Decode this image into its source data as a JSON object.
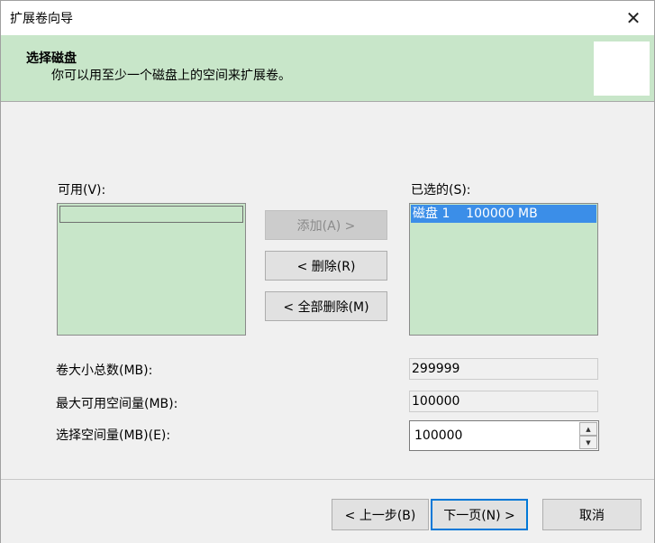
{
  "window": {
    "title": "扩展卷向导",
    "close_glyph": "✕"
  },
  "header": {
    "title": "选择磁盘",
    "subtitle": "你可以用至少一个磁盘上的空间来扩展卷。"
  },
  "available": {
    "label": "可用(V):"
  },
  "selected": {
    "label": "已选的(S):",
    "items": [
      "磁盘 1    100000 MB"
    ]
  },
  "buttons": {
    "add": "添加(A) >",
    "remove": "< 删除(R)",
    "remove_all": "< 全部删除(M)"
  },
  "fields": {
    "total_label": "卷大小总数(MB):",
    "total_value": "299999",
    "max_label": "最大可用空间量(MB):",
    "max_value": "100000",
    "select_label": "选择空间量(MB)(E):",
    "select_value": "100000"
  },
  "footer": {
    "back": "< 上一步(B)",
    "next": "下一页(N) >",
    "cancel": "取消"
  },
  "colors": {
    "accent_green": "#c8e6c9",
    "selection_blue": "#3b8ee8",
    "focus_blue": "#0078d7"
  }
}
